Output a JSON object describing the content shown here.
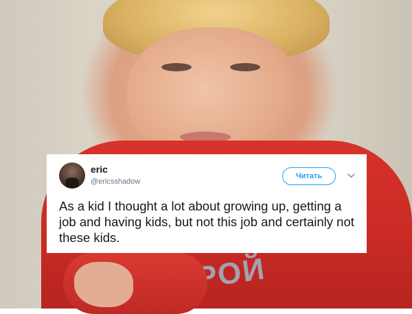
{
  "tweet": {
    "author_name": "eric",
    "author_handle": "@ericsshadow",
    "follow_button_label": "Читать",
    "text": "As a kid I thought a lot about growing up, getting a job and having kids, but not this job and certainly not these kids.",
    "avatar_icon": "user-avatar",
    "menu_icon": "chevron-down-icon",
    "accent_color": "#1da1f2"
  },
  "background": {
    "shirt_text": "КРОЙ"
  }
}
